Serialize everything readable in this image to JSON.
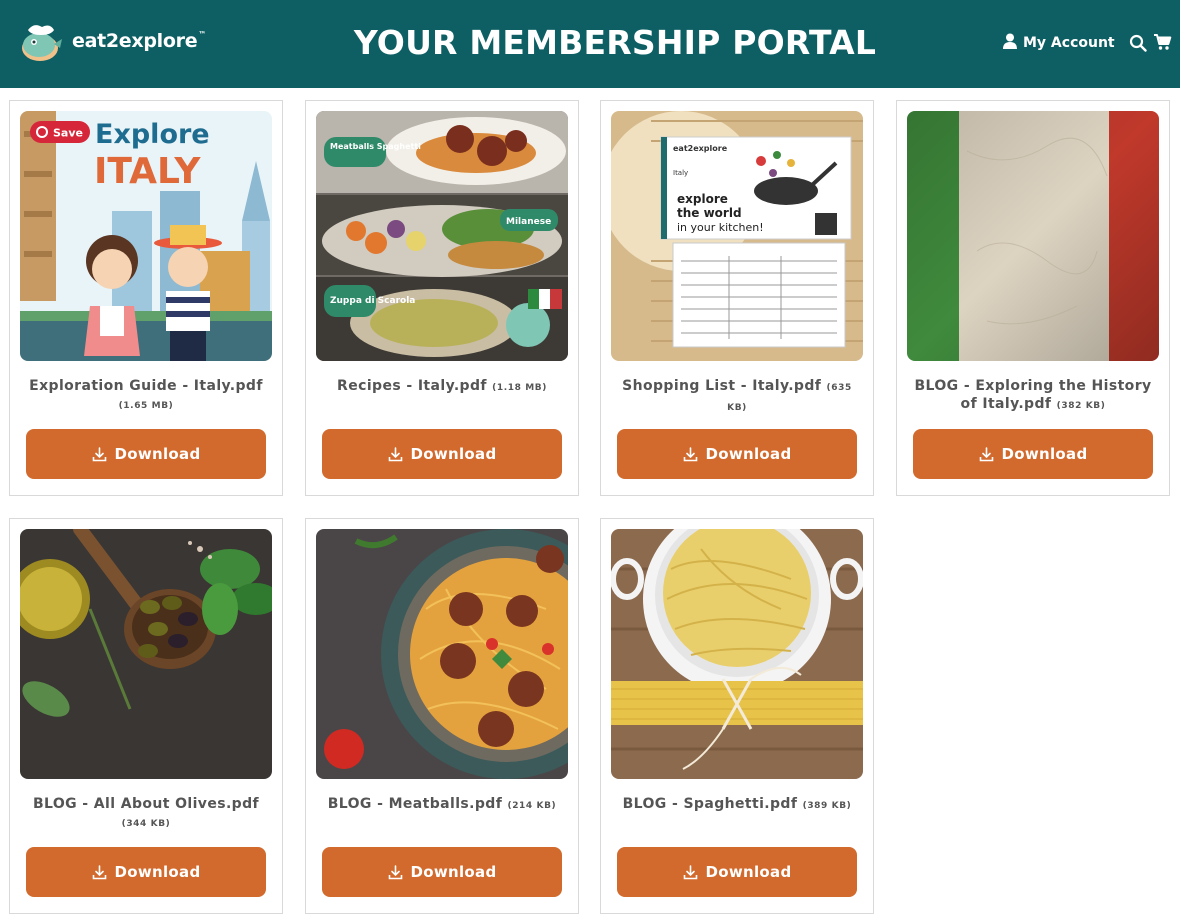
{
  "header": {
    "brand_name": "eat2explore",
    "brand_tm": "™",
    "title": "YOUR MEMBERSHIP PORTAL",
    "account_label": "My Account",
    "icons": [
      "user-icon",
      "search-icon",
      "cart-icon"
    ]
  },
  "colors": {
    "header_bg": "#0e5f63",
    "button_bg": "#d26a2d",
    "caption_text": "#555555"
  },
  "files": [
    {
      "name": "Exploration Guide - Italy.pdf",
      "size": "(1.65 MB)",
      "button": "Download"
    },
    {
      "name": "Recipes - Italy.pdf",
      "size": "(1.18 MB)",
      "button": "Download"
    },
    {
      "name": "Shopping List - Italy.pdf",
      "size": "(635 KB)",
      "button": "Download"
    },
    {
      "name": "BLOG - Exploring the History of Italy.pdf",
      "size": "(382 KB)",
      "button": "Download"
    },
    {
      "name": "BLOG - All About Olives.pdf",
      "size": "(344 KB)",
      "button": "Download"
    },
    {
      "name": "BLOG - Meatballs.pdf",
      "size": "(214 KB)",
      "button": "Download"
    },
    {
      "name": "BLOG - Spaghetti.pdf",
      "size": "(389 KB)",
      "button": "Download"
    }
  ],
  "thumb_text": {
    "guide_save": "Save",
    "guide_explore": "Explore",
    "guide_country": "ITALY",
    "recipes_tag1": "Meatballs Spaghetti",
    "recipes_tag2": "Milanese",
    "recipes_tag3": "Zuppa di Scarola",
    "box_brand": "eat2explore",
    "box_country": "Italy",
    "box_tagline1": "explore",
    "box_tagline2": "the world",
    "box_tagline3": "in your kitchen!"
  }
}
